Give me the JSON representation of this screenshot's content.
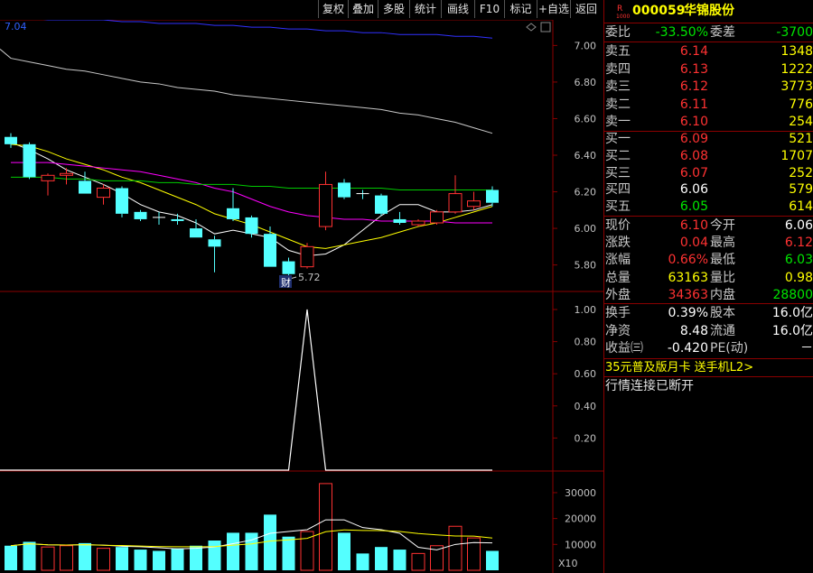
{
  "toolbar": {
    "buttons": [
      "复权",
      "叠加",
      "多股",
      "统计",
      "画线",
      "F10",
      "标记",
      "+自选",
      "返回"
    ]
  },
  "chart": {
    "top_left_label": "7.04",
    "low_marker": "5.72",
    "finance_tag": "财",
    "price_axis": [
      "7.00",
      "6.80",
      "6.60",
      "6.40",
      "6.20",
      "6.00",
      "5.80"
    ],
    "indicator_axis": [
      "1.00",
      "0.80",
      "0.60",
      "0.40",
      "0.20"
    ],
    "volume_axis": [
      "30000",
      "20000",
      "10000"
    ],
    "volume_unit": "X10"
  },
  "chart_data": {
    "type": "candlestick",
    "candles": [
      {
        "o": 6.46,
        "c": 6.5,
        "h": 6.52,
        "l": 6.44,
        "dir": "down"
      },
      {
        "o": 6.46,
        "c": 6.28,
        "h": 6.47,
        "l": 6.27,
        "dir": "down"
      },
      {
        "o": 6.26,
        "c": 6.29,
        "h": 6.3,
        "l": 6.18,
        "dir": "up"
      },
      {
        "o": 6.29,
        "c": 6.3,
        "h": 6.33,
        "l": 6.24,
        "dir": "up"
      },
      {
        "o": 6.26,
        "c": 6.19,
        "h": 6.31,
        "l": 6.19,
        "dir": "down"
      },
      {
        "o": 6.17,
        "c": 6.22,
        "h": 6.24,
        "l": 6.13,
        "dir": "up"
      },
      {
        "o": 6.22,
        "c": 6.08,
        "h": 6.23,
        "l": 6.06,
        "dir": "down"
      },
      {
        "o": 6.09,
        "c": 6.05,
        "h": 6.1,
        "l": 6.04,
        "dir": "down"
      },
      {
        "o": 6.06,
        "c": 6.06,
        "h": 6.09,
        "l": 6.02,
        "dir": "down"
      },
      {
        "o": 6.05,
        "c": 6.04,
        "h": 6.08,
        "l": 6.02,
        "dir": "down"
      },
      {
        "o": 6.0,
        "c": 5.95,
        "h": 6.05,
        "l": 5.95,
        "dir": "down"
      },
      {
        "o": 5.94,
        "c": 5.9,
        "h": 5.96,
        "l": 5.76,
        "dir": "down"
      },
      {
        "o": 6.11,
        "c": 6.05,
        "h": 6.22,
        "l": 6.04,
        "dir": "down"
      },
      {
        "o": 6.06,
        "c": 5.97,
        "h": 6.07,
        "l": 5.95,
        "dir": "down"
      },
      {
        "o": 5.97,
        "c": 5.79,
        "h": 6.01,
        "l": 5.79,
        "dir": "down"
      },
      {
        "o": 5.82,
        "c": 5.75,
        "h": 5.84,
        "l": 5.72,
        "dir": "down"
      },
      {
        "o": 5.79,
        "c": 5.9,
        "h": 5.92,
        "l": 5.78,
        "dir": "up"
      },
      {
        "o": 6.01,
        "c": 6.24,
        "h": 6.31,
        "l": 5.99,
        "dir": "up"
      },
      {
        "o": 6.25,
        "c": 6.17,
        "h": 6.27,
        "l": 6.16,
        "dir": "down"
      },
      {
        "o": 6.19,
        "c": 6.19,
        "h": 6.21,
        "l": 6.16,
        "dir": "down"
      },
      {
        "o": 6.18,
        "c": 6.08,
        "h": 6.19,
        "l": 6.07,
        "dir": "down"
      },
      {
        "o": 6.05,
        "c": 6.03,
        "h": 6.09,
        "l": 6.02,
        "dir": "down"
      },
      {
        "o": 6.02,
        "c": 6.04,
        "h": 6.05,
        "l": 6.01,
        "dir": "up"
      },
      {
        "o": 6.03,
        "c": 6.09,
        "h": 6.1,
        "l": 6.02,
        "dir": "up"
      },
      {
        "o": 6.09,
        "c": 6.19,
        "h": 6.29,
        "l": 6.08,
        "dir": "up"
      },
      {
        "o": 6.12,
        "c": 6.15,
        "h": 6.2,
        "l": 6.1,
        "dir": "up"
      },
      {
        "o": 6.21,
        "c": 6.14,
        "h": 6.23,
        "l": 6.12,
        "dir": "down"
      }
    ],
    "ma_lines": [
      {
        "color": "#ffffff",
        "values": [
          6.47,
          6.43,
          6.38,
          6.32,
          6.28,
          6.24,
          6.19,
          6.13,
          6.09,
          6.07,
          6.03,
          5.97,
          5.99,
          5.97,
          5.95,
          5.88,
          5.85,
          5.86,
          5.91,
          5.99,
          6.07,
          6.13,
          6.13,
          6.09,
          6.09,
          6.1,
          6.13
        ]
      },
      {
        "color": "#ffff00",
        "values": [
          6.46,
          6.45,
          6.42,
          6.38,
          6.35,
          6.32,
          6.28,
          6.25,
          6.21,
          6.17,
          6.13,
          6.08,
          6.05,
          6.02,
          5.98,
          5.94,
          5.9,
          5.89,
          5.91,
          5.93,
          5.95,
          5.98,
          6.01,
          6.03,
          6.06,
          6.09,
          6.12
        ]
      },
      {
        "color": "#ff00ff",
        "values": [
          6.36,
          6.36,
          6.36,
          6.35,
          6.34,
          6.33,
          6.32,
          6.31,
          6.29,
          6.27,
          6.25,
          6.22,
          6.2,
          6.16,
          6.12,
          6.09,
          6.07,
          6.06,
          6.05,
          6.05,
          6.04,
          6.04,
          6.04,
          6.04,
          6.03,
          6.03,
          6.03
        ]
      },
      {
        "color": "#00cc00",
        "values": [
          6.28,
          6.28,
          6.28,
          6.27,
          6.27,
          6.26,
          6.26,
          6.26,
          6.25,
          6.25,
          6.24,
          6.24,
          6.24,
          6.23,
          6.23,
          6.22,
          6.22,
          6.22,
          6.22,
          6.22,
          6.22,
          6.21,
          6.21,
          6.21,
          6.21,
          6.21,
          6.21
        ]
      },
      {
        "color": "#c8c8c8",
        "values": [
          6.93,
          6.91,
          6.89,
          6.87,
          6.86,
          6.84,
          6.82,
          6.8,
          6.79,
          6.77,
          6.76,
          6.75,
          6.73,
          6.72,
          6.71,
          6.7,
          6.69,
          6.68,
          6.67,
          6.66,
          6.65,
          6.63,
          6.62,
          6.6,
          6.58,
          6.55,
          6.52
        ]
      },
      {
        "color": "#3030ff",
        "values": [
          7.15,
          7.15,
          7.14,
          7.14,
          7.14,
          7.14,
          7.13,
          7.13,
          7.12,
          7.12,
          7.12,
          7.11,
          7.11,
          7.1,
          7.1,
          7.09,
          7.09,
          7.08,
          7.08,
          7.07,
          7.07,
          7.06,
          7.06,
          7.06,
          7.05,
          7.05,
          7.04
        ]
      }
    ],
    "indicator": {
      "values": [
        0,
        0,
        0,
        0,
        0,
        0,
        0,
        0,
        0,
        0,
        0,
        0,
        0,
        0,
        0,
        0,
        1.0,
        0,
        0,
        0,
        0,
        0,
        0,
        0,
        0,
        0,
        0
      ]
    },
    "volume": [
      {
        "v": 9500,
        "dir": "down"
      },
      {
        "v": 11000,
        "dir": "down"
      },
      {
        "v": 9000,
        "dir": "up"
      },
      {
        "v": 9500,
        "dir": "up"
      },
      {
        "v": 10500,
        "dir": "down"
      },
      {
        "v": 8500,
        "dir": "up"
      },
      {
        "v": 9000,
        "dir": "down"
      },
      {
        "v": 8000,
        "dir": "down"
      },
      {
        "v": 7500,
        "dir": "down"
      },
      {
        "v": 8500,
        "dir": "down"
      },
      {
        "v": 9500,
        "dir": "down"
      },
      {
        "v": 11500,
        "dir": "down"
      },
      {
        "v": 14500,
        "dir": "down"
      },
      {
        "v": 14500,
        "dir": "down"
      },
      {
        "v": 21500,
        "dir": "down"
      },
      {
        "v": 13000,
        "dir": "down"
      },
      {
        "v": 15000,
        "dir": "up"
      },
      {
        "v": 33500,
        "dir": "up"
      },
      {
        "v": 14500,
        "dir": "down"
      },
      {
        "v": 6500,
        "dir": "down"
      },
      {
        "v": 9000,
        "dir": "down"
      },
      {
        "v": 8000,
        "dir": "down"
      },
      {
        "v": 6500,
        "dir": "up"
      },
      {
        "v": 9500,
        "dir": "up"
      },
      {
        "v": 17000,
        "dir": "up"
      },
      {
        "v": 12500,
        "dir": "up"
      },
      {
        "v": 7500,
        "dir": "down"
      }
    ],
    "price_range": [
      5.66,
      7.14
    ],
    "volume_range": [
      0,
      38000
    ]
  },
  "quote": {
    "code": "000059",
    "name": "华锦股份",
    "badge": "R",
    "badge_sub": "1000",
    "ratio_label": "委比",
    "ratio_value": "-33.50%",
    "diff_label": "委差",
    "diff_value": "-3700",
    "asks": [
      {
        "label": "卖五",
        "price": "6.14",
        "vol": "1348"
      },
      {
        "label": "卖四",
        "price": "6.13",
        "vol": "1222"
      },
      {
        "label": "卖三",
        "price": "6.12",
        "vol": "3773"
      },
      {
        "label": "卖二",
        "price": "6.11",
        "vol": "776"
      },
      {
        "label": "卖一",
        "price": "6.10",
        "vol": "254"
      }
    ],
    "bids": [
      {
        "label": "买一",
        "price": "6.09",
        "vol": "521"
      },
      {
        "label": "买二",
        "price": "6.08",
        "vol": "1707"
      },
      {
        "label": "买三",
        "price": "6.07",
        "vol": "252"
      },
      {
        "label": "买四",
        "price": "6.06",
        "vol": "579"
      },
      {
        "label": "买五",
        "price": "6.05",
        "vol": "614"
      }
    ],
    "stats": [
      {
        "l1": "现价",
        "v1": "6.10",
        "l2": "今开",
        "v2": "6.06"
      },
      {
        "l1": "涨跌",
        "v1": "0.04",
        "l2": "最高",
        "v2": "6.12"
      },
      {
        "l1": "涨幅",
        "v1": "0.66%",
        "l2": "最低",
        "v2": "6.03"
      },
      {
        "l1": "总量",
        "v1": "63163",
        "l2": "量比",
        "v2": "0.98"
      },
      {
        "l1": "外盘",
        "v1": "34363",
        "l2": "内盘",
        "v2": "28800"
      }
    ],
    "stats2": [
      {
        "l1": "换手",
        "v1": "0.39%",
        "l2": "股本",
        "v2": "16.0亿"
      },
      {
        "l1": "净资",
        "v1": "8.48",
        "l2": "流通",
        "v2": "16.0亿"
      },
      {
        "l1": "收益㈢",
        "v1": "-0.420",
        "l2": "PE(动)",
        "v2": "－"
      }
    ],
    "promo": "35元普及版月卡 送手机L2>",
    "status": "行情连接已断开"
  }
}
